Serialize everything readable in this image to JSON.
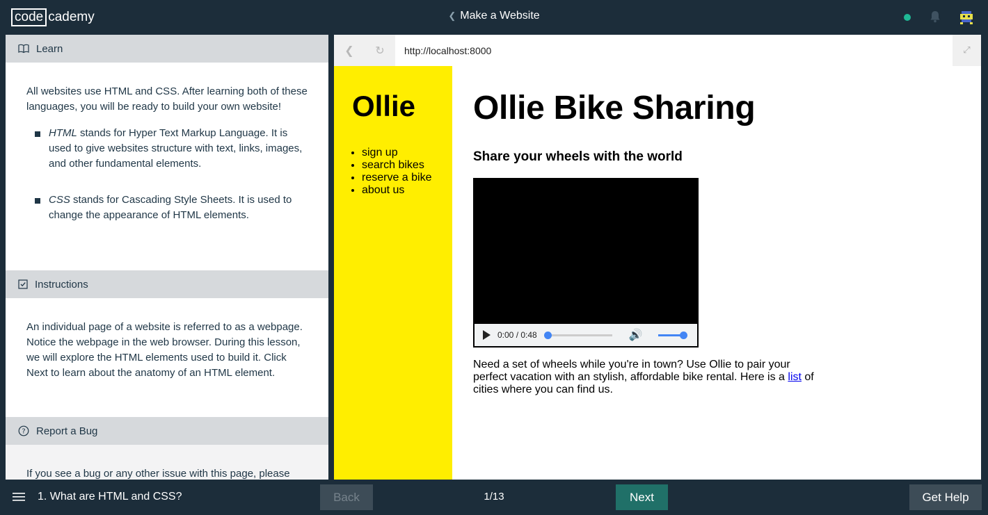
{
  "header": {
    "logo_box": "code",
    "logo_rest": "cademy",
    "course_title": "Make a Website"
  },
  "learn": {
    "title": "Learn",
    "intro": "All websites use HTML and CSS. After learning both of these languages, you will be ready to build your own website!",
    "bullets": [
      {
        "term": "HTML",
        "text": " stands for Hyper Text Markup Language. It is used to give websites structure with text, links, images, and other fundamental elements."
      },
      {
        "term": "CSS",
        "text": " stands for Cascading Style Sheets. It is used to change the appearance of HTML elements."
      }
    ]
  },
  "instructions": {
    "title": "Instructions",
    "text": "An individual page of a website is referred to as a webpage. Notice the webpage in the web browser. During this lesson, we will explore the HTML elements used to build it. Click Next to learn about the anatomy of an HTML element."
  },
  "report_bug": {
    "title": "Report a Bug",
    "text": "If you see a bug or any other issue with this page, please"
  },
  "browser": {
    "url": "http://localhost:8000"
  },
  "site": {
    "brand": "Ollie",
    "nav": [
      "sign up",
      "search bikes",
      "reserve a bike",
      "about us"
    ],
    "heading": "Ollie Bike Sharing",
    "subheading": "Share your wheels with the world",
    "video_time": "0:00 / 0:48",
    "video_progress": 0,
    "volume_level": 1,
    "paragraph_before_link": "Need a set of wheels while you're in town? Use Ollie to pair your perfect vacation with an stylish, affordable bike rental. Here is a ",
    "link_text": "list",
    "paragraph_after_link": " of cities where you can find us."
  },
  "footer": {
    "lesson_title": "1. What are HTML and CSS?",
    "back_label": "Back",
    "page_count": "1/13",
    "next_label": "Next",
    "help_label": "Get Help"
  },
  "colors": {
    "bar_bg": "#1c2d3a",
    "site_sidebar": "#ffee00",
    "next_button": "#207068",
    "status_online": "#1fb895"
  }
}
